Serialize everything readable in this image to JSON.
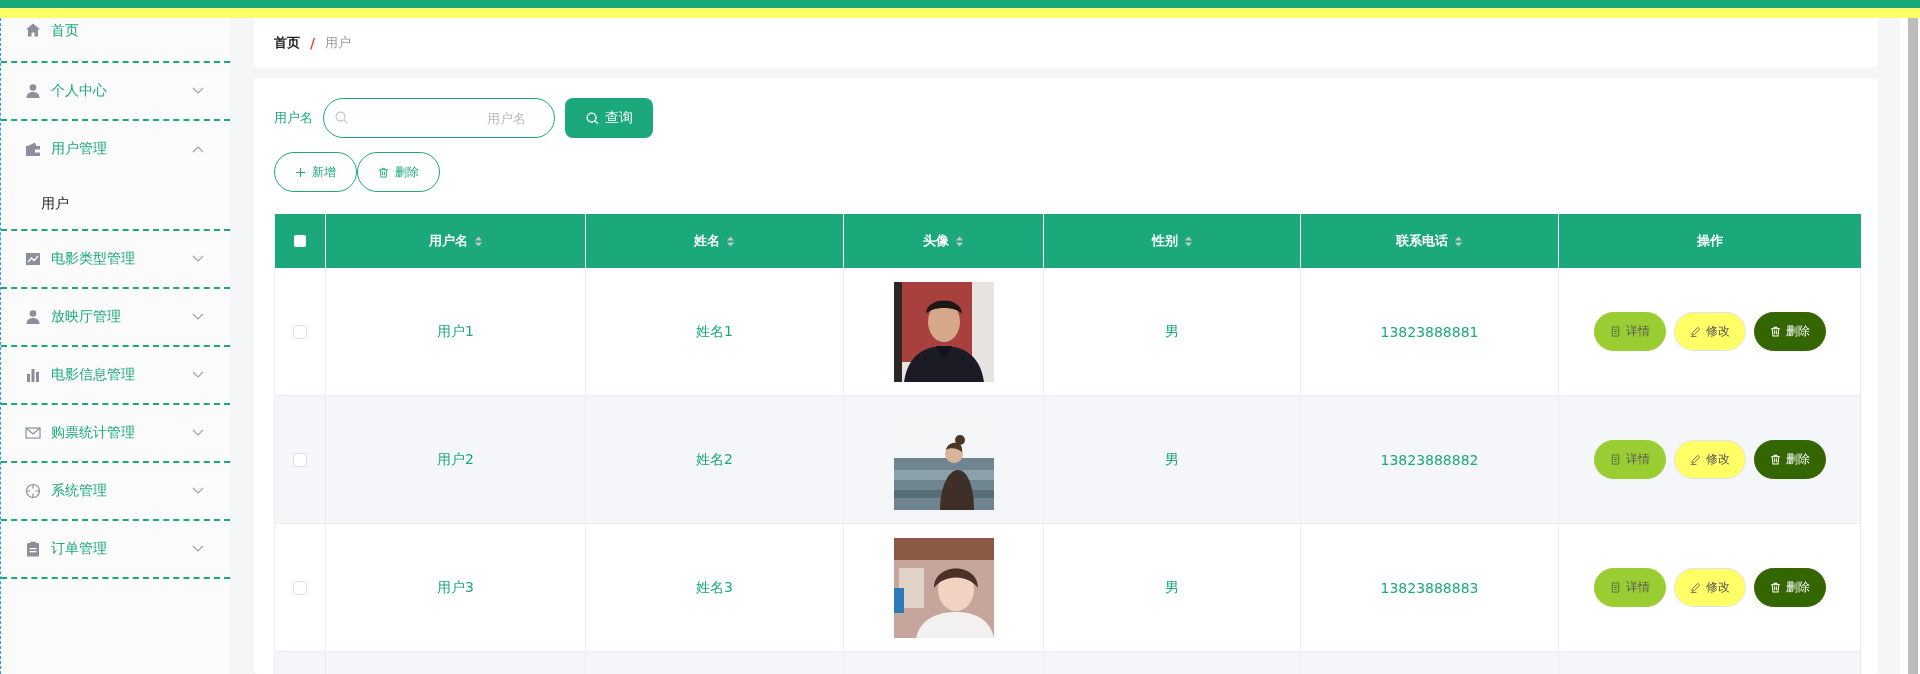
{
  "sidebar": {
    "items": [
      {
        "kind": "link",
        "label": "首页"
      },
      {
        "kind": "submenu",
        "label": "个人中心",
        "expanded": false
      },
      {
        "kind": "submenu",
        "label": "用户管理",
        "expanded": true,
        "children": [
          {
            "label": "用户",
            "selected": true
          }
        ]
      },
      {
        "kind": "submenu",
        "label": "电影类型管理",
        "expanded": false
      },
      {
        "kind": "submenu",
        "label": "放映厅管理",
        "expanded": false
      },
      {
        "kind": "submenu",
        "label": "电影信息管理",
        "expanded": false
      },
      {
        "kind": "submenu",
        "label": "购票统计管理",
        "expanded": false
      },
      {
        "kind": "submenu",
        "label": "系统管理",
        "expanded": false
      },
      {
        "kind": "submenu",
        "label": "订单管理",
        "expanded": false
      }
    ]
  },
  "breadcrumb": {
    "items": [
      "首页",
      "用户"
    ],
    "separator": "/"
  },
  "search": {
    "label": "用户名",
    "placeholder": "用户名",
    "button": "查询"
  },
  "toolbar": [
    {
      "kind": "add",
      "label": "新增"
    },
    {
      "kind": "delete",
      "label": "删除"
    }
  ],
  "table": {
    "select_all_checked": false,
    "columns": [
      {
        "label": "用户名",
        "sortable": true
      },
      {
        "label": "姓名",
        "sortable": true
      },
      {
        "label": "头像",
        "sortable": true
      },
      {
        "label": "性别",
        "sortable": true
      },
      {
        "label": "联系电话",
        "sortable": true
      },
      {
        "label": "操作",
        "sortable": false
      }
    ],
    "rows": [
      {
        "selected": false,
        "username": "用户1",
        "name": "姓名1",
        "gender": "男",
        "phone": "13823888881",
        "actions": [
          {
            "kind": "detail",
            "label": "详情"
          },
          {
            "kind": "edit",
            "label": "修改"
          },
          {
            "kind": "delete",
            "label": "删除"
          }
        ]
      },
      {
        "selected": false,
        "username": "用户2",
        "name": "姓名2",
        "gender": "男",
        "phone": "13823888882",
        "actions": [
          {
            "kind": "detail",
            "label": "详情"
          },
          {
            "kind": "edit",
            "label": "修改"
          },
          {
            "kind": "delete",
            "label": "删除"
          }
        ]
      },
      {
        "selected": false,
        "username": "用户3",
        "name": "姓名3",
        "gender": "男",
        "phone": "13823888883",
        "actions": [
          {
            "kind": "detail",
            "label": "详情"
          },
          {
            "kind": "edit",
            "label": "修改"
          },
          {
            "kind": "delete",
            "label": "删除"
          }
        ]
      }
    ]
  }
}
